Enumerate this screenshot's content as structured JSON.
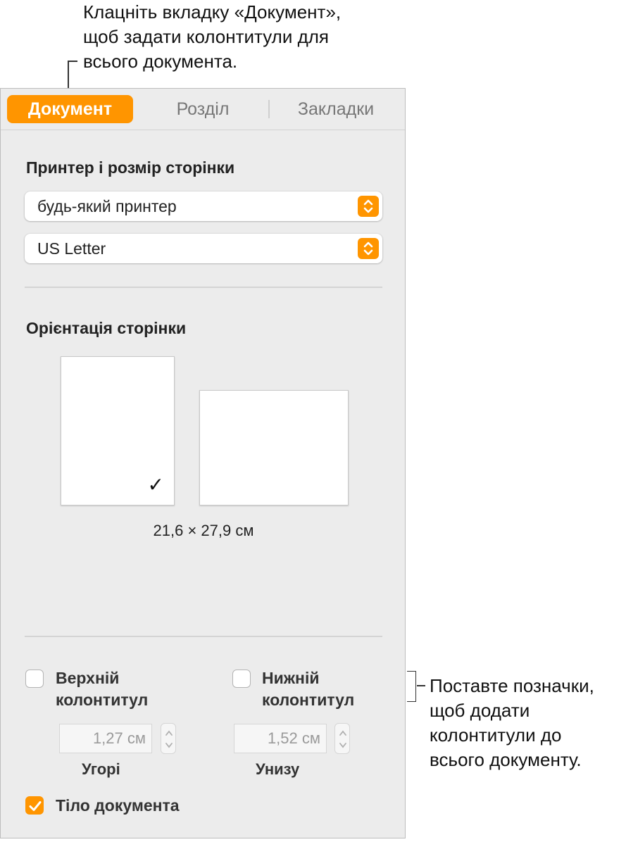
{
  "callouts": {
    "top": [
      "Клацніть вкладку «Документ»,",
      "щоб задати колонтитули для",
      "всього документа."
    ],
    "right": [
      "Поставте позначки,",
      "щоб додати",
      "колонтитули до",
      "всього документу."
    ]
  },
  "tabs": [
    {
      "label": "Документ",
      "active": true
    },
    {
      "label": "Розділ",
      "active": false
    },
    {
      "label": "Закладки",
      "active": false
    }
  ],
  "printer_section": {
    "title": "Принтер і розмір сторінки",
    "printer_value": "будь-який принтер",
    "paper_value": "US Letter"
  },
  "orientation_section": {
    "title": "Орієнтація сторінки",
    "selected": "portrait",
    "check_glyph": "✓",
    "size_label": "21,6 × 27,9 см"
  },
  "header_footer": {
    "header_checkbox_label": "Верхній колонтитул",
    "header_checked": false,
    "header_value": "1,27 см",
    "header_caption": "Угорі",
    "footer_checkbox_label": "Нижній колонтитул",
    "footer_checked": false,
    "footer_value": "1,52 см",
    "footer_caption": "Унизу",
    "body_checkbox_label": "Тіло документа",
    "body_checked": true
  },
  "colors": {
    "accent": "#ff9500",
    "panel_bg": "#ececec"
  },
  "icons": {
    "popup_arrows": "chevron-up-down-icon",
    "checkbox_mark": "checkmark-icon"
  }
}
